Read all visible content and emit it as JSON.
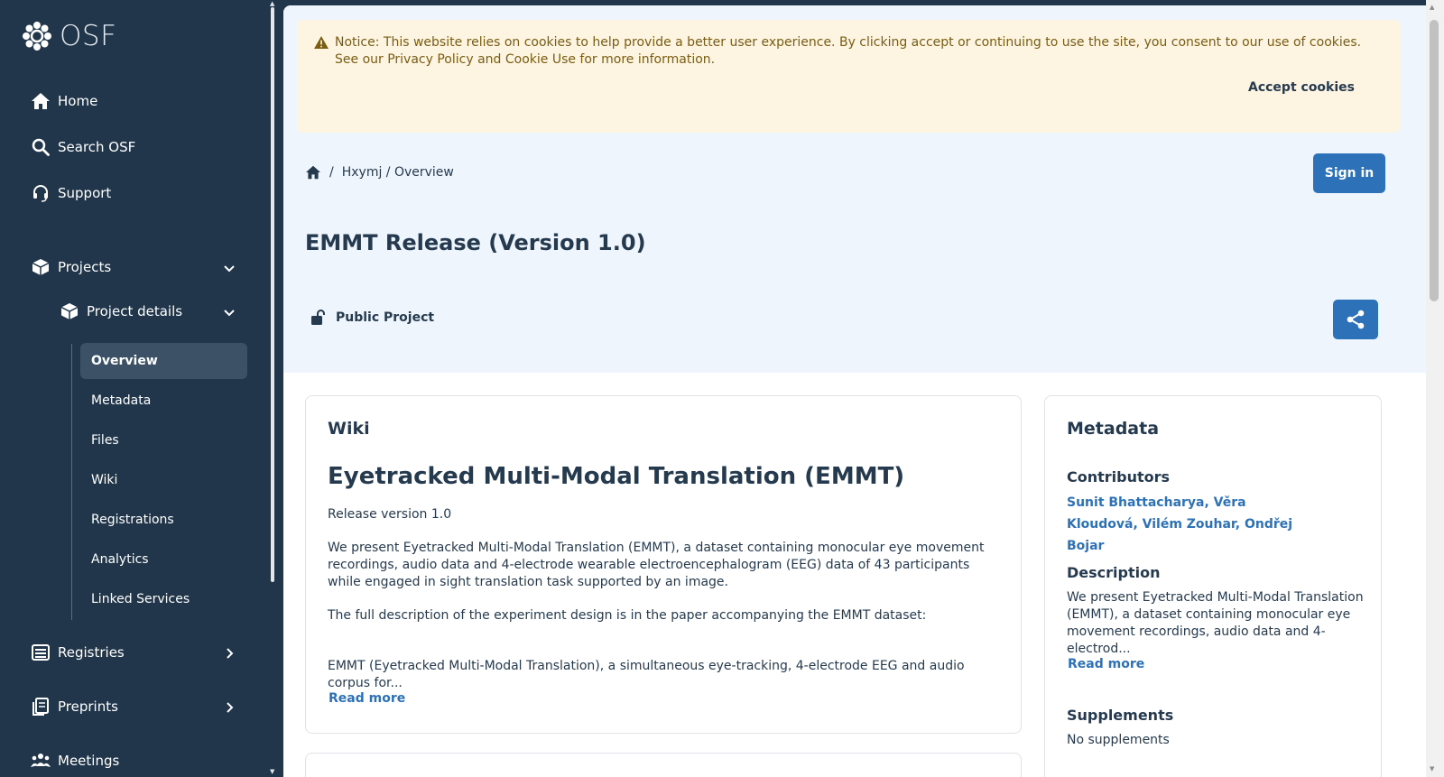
{
  "sidebar": {
    "logo_text": "OSF",
    "nav": {
      "home": "Home",
      "search": "Search OSF",
      "support": "Support",
      "projects": "Projects",
      "project_details": "Project details",
      "registries": "Registries",
      "preprints": "Preprints",
      "meetings": "Meetings"
    },
    "sub_items": [
      {
        "label": "Overview",
        "active": true
      },
      {
        "label": "Metadata"
      },
      {
        "label": "Files"
      },
      {
        "label": "Wiki"
      },
      {
        "label": "Registrations"
      },
      {
        "label": "Analytics"
      },
      {
        "label": "Linked Services"
      }
    ]
  },
  "notice": {
    "text": "Notice: This website relies on cookies to help provide a better user experience. By clicking accept or continuing to use the site, you consent to our use of cookies. See our Privacy Policy and Cookie Use for more information.",
    "accept": "Accept cookies"
  },
  "breadcrumb": {
    "separator": "/",
    "project": "Hxymj / Overview"
  },
  "header": {
    "sign_in": "Sign in",
    "title": "EMMT Release (Version 1.0)",
    "visibility": "Public Project"
  },
  "wiki": {
    "heading": "Wiki",
    "title": "Eyetracked Multi-Modal Translation (EMMT)",
    "release": "Release version 1.0",
    "para1": "We present Eyetracked Multi-Modal Translation (EMMT), a dataset containing monocular eye movement recordings, audio data and 4-electrode wearable electroencephalogram (EEG) data of 43 participants while engaged in sight translation task supported by an image.",
    "para2": "The full description of the experiment design is in the paper accompanying the EMMT dataset:",
    "para3": "EMMT (Eyetracked Multi-Modal Translation), a simultaneous eye-tracking, 4-electrode EEG and audio corpus for...",
    "read_more": "Read more"
  },
  "metadata": {
    "heading": "Metadata",
    "contributors_label": "Contributors",
    "contributors": "Sunit Bhattacharya, Věra Kloudová, Vilém Zouhar, Ondřej Bojar",
    "description_label": "Description",
    "description": "We present Eyetracked Multi-Modal Translation (EMMT), a dataset containing monocular eye movement recordings, audio data and 4-electrod...",
    "read_more": "Read more",
    "supplements_label": "Supplements",
    "supplements": "No supplements"
  },
  "colors": {
    "sidebar_bg": "#21364b",
    "accent": "#2d72b8",
    "header_bg": "#eff5fc",
    "notice_bg": "#fdf5e2"
  }
}
